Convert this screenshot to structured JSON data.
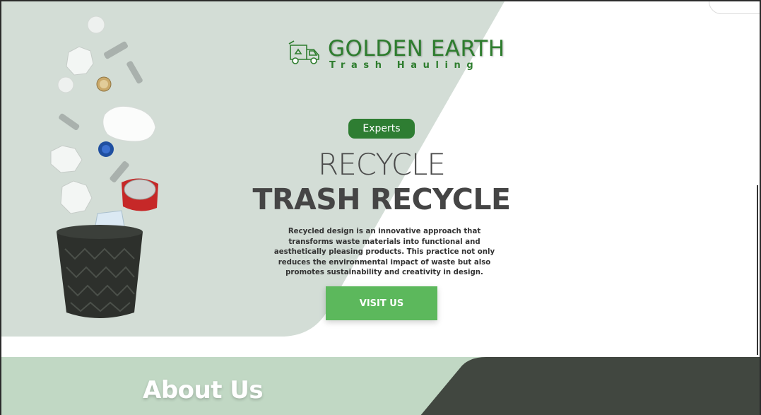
{
  "brand": {
    "name": "GOLDEN EARTH",
    "tagline": "Trash Hauling",
    "logo_icon": "recycling-truck-icon"
  },
  "hero": {
    "badge": "Experts",
    "headline_light": "RECYCLE",
    "headline_bold": "TRASH RECYCLE",
    "description": "Recycled design is an innovative approach that transforms waste materials into functional and aesthetically pleasing products. This practice not only reduces the environmental impact of waste but also promotes sustainability and creativity in design.",
    "cta_label": "VISIT US",
    "image": "trash-basket-with-recyclables-illustration"
  },
  "about": {
    "title": "About Us"
  },
  "colors": {
    "brand_green": "#2e7d2e",
    "badge_green": "#2e7d32",
    "button_green": "#5cb85c",
    "hero_bg": "#d3ddd6",
    "about_bg": "#c1d8c4",
    "dark_panel": "#414740",
    "headline_gray": "#4a4a4a"
  }
}
